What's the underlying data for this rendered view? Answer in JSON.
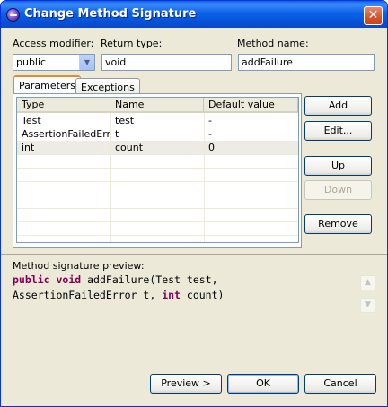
{
  "window": {
    "title": "Change Method Signature",
    "close_glyph": "✕"
  },
  "fields": {
    "access_modifier_label": "Access modifier:",
    "access_modifier_value": "public",
    "return_type_label": "Return type:",
    "return_type_value": "void",
    "method_name_label": "Method name:",
    "method_name_value": "addFailure"
  },
  "tabs": [
    {
      "label": "Parameters",
      "active": true
    },
    {
      "label": "Exceptions",
      "active": false
    }
  ],
  "table": {
    "headers": [
      "Type",
      "Name",
      "Default value"
    ],
    "rows": [
      {
        "type": "Test",
        "name": "test",
        "default": "-"
      },
      {
        "type": "AssertionFailedError",
        "name": "t",
        "default": "-"
      },
      {
        "type": "int",
        "name": "count",
        "default": "0"
      }
    ],
    "selected_row": 2
  },
  "side_buttons": {
    "add": "Add",
    "edit": "Edit...",
    "up": "Up",
    "down": "Down",
    "remove": "Remove"
  },
  "preview": {
    "label": "Method signature preview:",
    "line1_kw1": "public",
    "line1_kw2": "void",
    "line1_rest": "addFailure(Test test,",
    "line2_pre": "AssertionFailedError t,",
    "line2_kw": "int",
    "line2_rest": "count)"
  },
  "footer": {
    "preview_button": "Preview >",
    "ok_button": "OK",
    "cancel_button": "Cancel"
  },
  "colors": {
    "title_bar": "#0b62ea",
    "dialog_bg": "#ece9d8",
    "keyword": "#7f0055",
    "close_button": "#d4532c"
  }
}
